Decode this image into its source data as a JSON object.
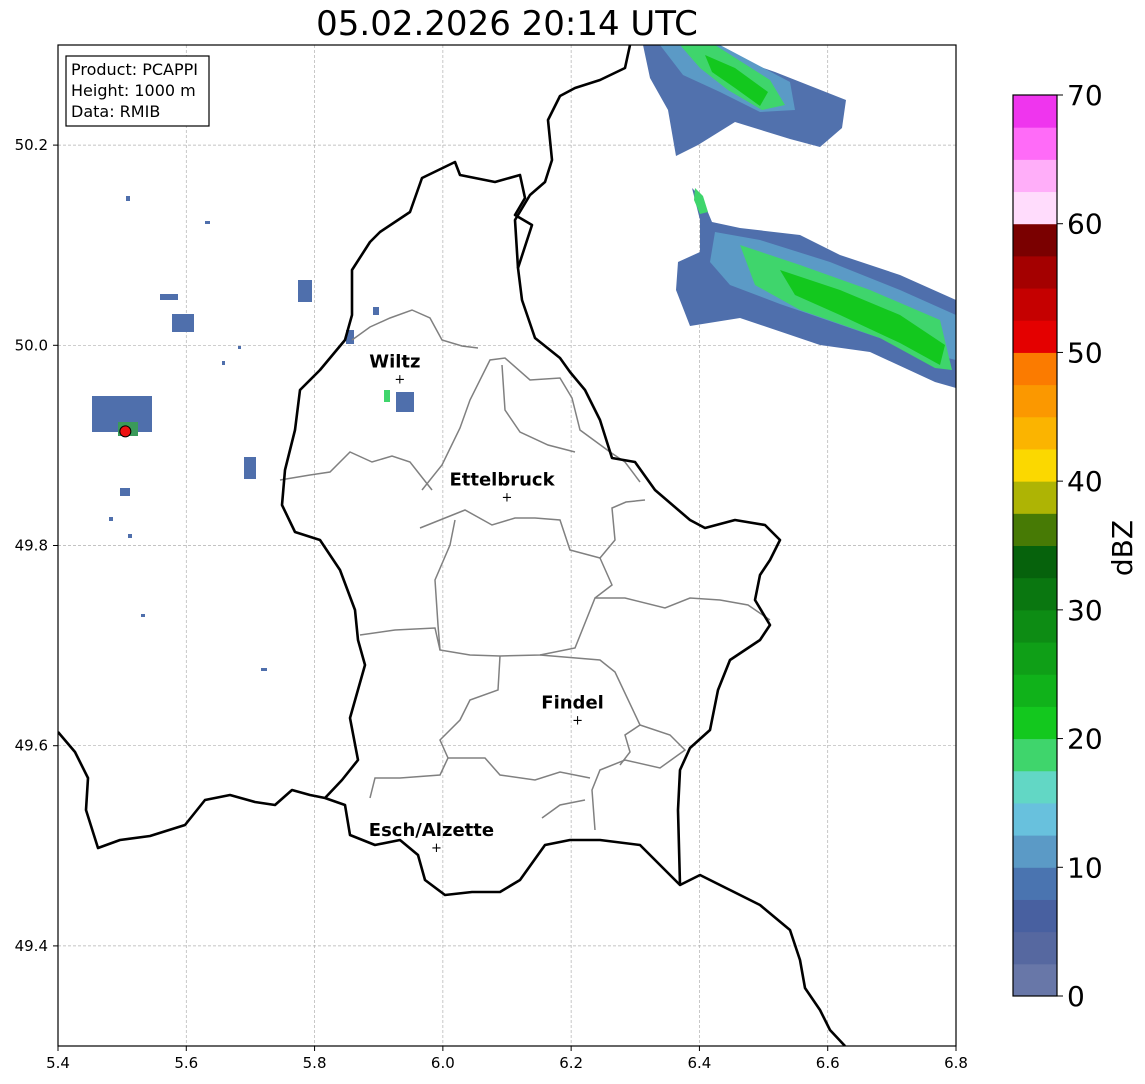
{
  "title": "05.02.2026 20:14 UTC",
  "info": {
    "product": "Product: PCAPPI",
    "height": "Height: 1000 m",
    "data": "Data: RMIB"
  },
  "axes": {
    "x_ticks": [
      "5.4",
      "5.6",
      "5.8",
      "6.0",
      "6.2",
      "6.4",
      "6.6",
      "6.8"
    ],
    "y_ticks": [
      "50.2",
      "50.0",
      "49.8",
      "49.6",
      "49.4"
    ],
    "x_values": [
      5.4,
      5.6,
      5.8,
      6.0,
      6.2,
      6.4,
      6.6,
      6.8
    ],
    "y_values": [
      50.2,
      50.0,
      49.8,
      49.6,
      49.4
    ],
    "xlim": [
      5.4,
      6.8
    ],
    "ylim": [
      49.3,
      50.3
    ],
    "grid": true
  },
  "cities": [
    {
      "name": "Wiltz",
      "lon": 5.933,
      "lat": 49.968
    },
    {
      "name": "Ettelbruck",
      "lon": 6.1,
      "lat": 49.85
    },
    {
      "name": "Findel",
      "lon": 6.21,
      "lat": 49.627
    },
    {
      "name": "Esch/Alzette",
      "lon": 5.99,
      "lat": 49.5
    }
  ],
  "radar_site": {
    "lon": 5.505,
    "lat": 49.914
  },
  "colorbar": {
    "label": "dBZ",
    "tick_labels": [
      "0",
      "10",
      "20",
      "30",
      "40",
      "50",
      "60",
      "70"
    ],
    "range": [
      0,
      70
    ],
    "step": 2.5,
    "colors": [
      "#6877a8",
      "#5668a0",
      "#4860a0",
      "#4a74b0",
      "#5b9ac6",
      "#68c1dd",
      "#62d7c5",
      "#3fd56c",
      "#13c81e",
      "#10b21a",
      "#0f9f17",
      "#0d8c14",
      "#0a7710",
      "#06620c",
      "#477a05",
      "#aeb404",
      "#fbd800",
      "#fbb400",
      "#fb9800",
      "#fb7b00",
      "#e40000",
      "#c50000",
      "#a40000",
      "#7a0000",
      "#ffdcfc",
      "#ffaef9",
      "#ff6bf8",
      "#ef35ee"
    ]
  }
}
